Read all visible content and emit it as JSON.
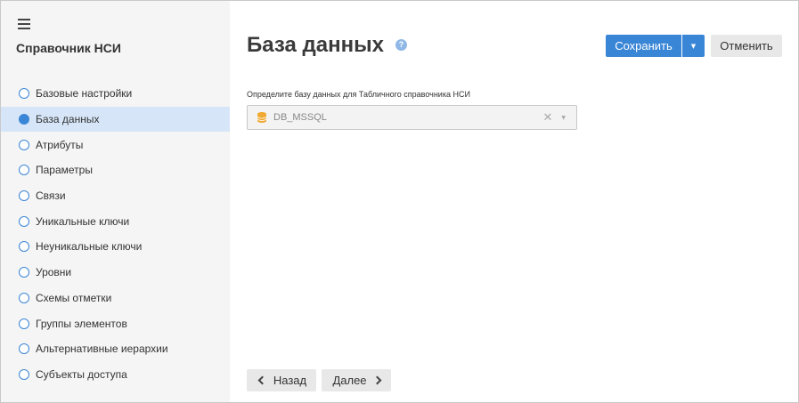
{
  "sidebar": {
    "title": "Справочник НСИ",
    "items": [
      {
        "label": "Базовые настройки",
        "active": false
      },
      {
        "label": "База данных",
        "active": true
      },
      {
        "label": "Атрибуты",
        "active": false
      },
      {
        "label": "Параметры",
        "active": false
      },
      {
        "label": "Связи",
        "active": false
      },
      {
        "label": "Уникальные ключи",
        "active": false
      },
      {
        "label": "Неуникальные ключи",
        "active": false
      },
      {
        "label": "Уровни",
        "active": false
      },
      {
        "label": "Схемы отметки",
        "active": false
      },
      {
        "label": "Группы элементов",
        "active": false
      },
      {
        "label": "Альтернативные иерархии",
        "active": false
      },
      {
        "label": "Субъекты доступа",
        "active": false
      }
    ]
  },
  "main": {
    "title": "База данных",
    "help_icon": "?",
    "field_label": "Определите базу данных для Табличного справочника НСИ",
    "database_value": "DB_MSSQL"
  },
  "toolbar": {
    "save_label": "Сохранить",
    "cancel_label": "Отменить"
  },
  "footer": {
    "back_label": "Назад",
    "next_label": "Далее"
  },
  "colors": {
    "accent": "#3a86d6",
    "active_bg": "#d6e6f8",
    "db_icon": "#f0a830"
  },
  "icons": {
    "menu": "hamburger-icon",
    "database": "database-icon",
    "clear": "close-icon",
    "dropdown": "caret-down-icon"
  }
}
